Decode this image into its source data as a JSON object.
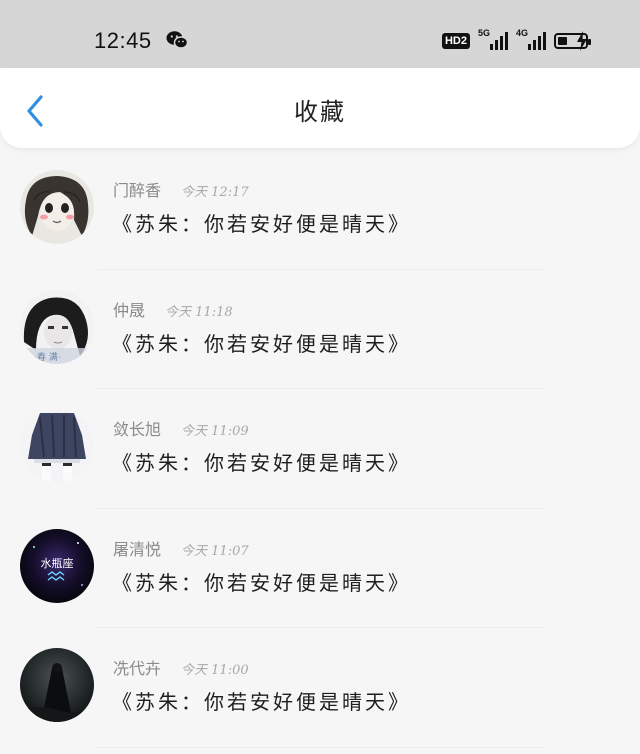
{
  "status_bar": {
    "time": "12:45",
    "hd_label": "HD2",
    "network_1": "5G",
    "network_2": "4G",
    "battery_level": 0.35
  },
  "header": {
    "title": "收藏"
  },
  "favorites": [
    {
      "name": "门醉香",
      "time": "今天 12:17",
      "message": "《苏朱：你若安好便是晴天》",
      "avatar": "girl-drawing-avatar"
    },
    {
      "name": "仲晟",
      "time": "今天 11:18",
      "message": "《苏朱：你若安好便是晴天》",
      "avatar": "girl-photo-avatar"
    },
    {
      "name": "敛长旭",
      "time": "今天 11:09",
      "message": "《苏朱：你若安好便是晴天》",
      "avatar": "skirt-avatar"
    },
    {
      "name": "屠清悦",
      "time": "今天 11:07",
      "message": "《苏朱：你若安好便是晴天》",
      "avatar": "aquarius-avatar",
      "avatar_text": "水瓶座"
    },
    {
      "name": "冼代卉",
      "time": "今天 11:00",
      "message": "《苏朱：你若安好便是晴天》",
      "avatar": "dark-figure-avatar"
    }
  ],
  "colors": {
    "accent": "#2f8fe0",
    "status_bar_bg": "#d6d6d6",
    "page_bg": "#f6f6f6"
  }
}
